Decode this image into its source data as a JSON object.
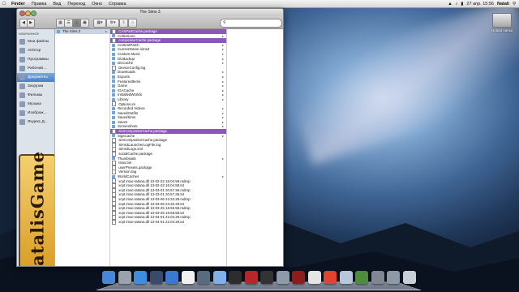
{
  "menubar": {
    "app": "Finder",
    "items": [
      "Правка",
      "Вид",
      "Переход",
      "Окно",
      "Справка"
    ],
    "clock": "27 апр.  15:56",
    "user": "Natali"
  },
  "desktop_icon": {
    "label": "Новая папка"
  },
  "window": {
    "title": "The Sims 3",
    "sidebar_heading": "ИЗБРАННОЕ",
    "sidebar": [
      {
        "label": "Мои файлы",
        "icon": "all-files-icon",
        "selected": false
      },
      {
        "label": "AirDrop",
        "icon": "airdrop-icon",
        "selected": false
      },
      {
        "label": "Программы",
        "icon": "applications-icon",
        "selected": false
      },
      {
        "label": "Рабочий...",
        "icon": "desktop-icon",
        "selected": false
      },
      {
        "label": "Документы",
        "icon": "documents-icon",
        "selected": true
      },
      {
        "label": "Загрузки",
        "icon": "downloads-icon",
        "selected": false
      },
      {
        "label": "Фильмы",
        "icon": "movies-icon",
        "selected": false
      },
      {
        "label": "Музыка",
        "icon": "music-icon",
        "selected": false
      },
      {
        "label": "Изображ...",
        "icon": "pictures-icon",
        "selected": false
      },
      {
        "label": "Яндекс.Д...",
        "icon": "yandex-disk-icon",
        "selected": false
      }
    ],
    "banner_text": "NatalisGame",
    "column1": [
      {
        "label": "The Sims 3",
        "folder": true
      }
    ],
    "column2": [
      {
        "label": "CASPartCache.package",
        "folder": false,
        "style": "hl"
      },
      {
        "label": "Collections",
        "folder": true,
        "style": ""
      },
      {
        "label": "compositorCache.package",
        "folder": false,
        "style": "hl"
      },
      {
        "label": "ContentPatch",
        "folder": true,
        "style": ""
      },
      {
        "label": "CurrentGame.sims3",
        "folder": true,
        "style": ""
      },
      {
        "label": "Custom Music",
        "folder": true,
        "style": ""
      },
      {
        "label": "DCBackup",
        "folder": true,
        "style": ""
      },
      {
        "label": "DCCache",
        "folder": true,
        "style": ""
      },
      {
        "label": "DeviceConfig.log",
        "folder": false,
        "style": ""
      },
      {
        "label": "Downloads",
        "folder": true,
        "style": ""
      },
      {
        "label": "Exports",
        "folder": true,
        "style": ""
      },
      {
        "label": "FeaturedItems",
        "folder": true,
        "style": ""
      },
      {
        "label": "Game",
        "folder": true,
        "style": ""
      },
      {
        "label": "IGACache",
        "folder": true,
        "style": ""
      },
      {
        "label": "InstalledWorlds",
        "folder": true,
        "style": ""
      },
      {
        "label": "Library",
        "folder": true,
        "style": ""
      },
      {
        "label": "Options.ini",
        "folder": false,
        "style": ""
      },
      {
        "label": "Recorded Videos",
        "folder": true,
        "style": ""
      },
      {
        "label": "SavedOutfits",
        "folder": true,
        "style": ""
      },
      {
        "label": "SavedSims",
        "folder": true,
        "style": ""
      },
      {
        "label": "Saves",
        "folder": true,
        "style": ""
      },
      {
        "label": "Screenshots",
        "folder": true,
        "style": ""
      },
      {
        "label": "simCompositorCache.package",
        "folder": false,
        "style": "hl"
      },
      {
        "label": "SigsCache",
        "folder": true,
        "style": ""
      },
      {
        "label": "simCompositorCache.package",
        "folder": false,
        "style": ""
      },
      {
        "label": "Sims3LauncherLogFile.log",
        "folder": false,
        "style": ""
      },
      {
        "label": "Sims3Logs.xml",
        "folder": false,
        "style": ""
      },
      {
        "label": "socialCache.package",
        "folder": false,
        "style": ""
      },
      {
        "label": "Thumbnails",
        "folder": true,
        "style": ""
      },
      {
        "label": "tslus.bin",
        "folder": false,
        "style": ""
      },
      {
        "label": "userPresets.package",
        "folder": false,
        "style": ""
      },
      {
        "label": "Version.tag",
        "folder": false,
        "style": ""
      },
      {
        "label": "WorldCaches",
        "folder": true,
        "style": ""
      },
      {
        "label": "xcpt imac-tatana.dll 13-02-22 16.04.58.mdmp",
        "folder": false,
        "style": ""
      },
      {
        "label": "xcpt imac-tatana.dll 13-02-22 16.04.58.txt",
        "folder": false,
        "style": ""
      },
      {
        "label": "xcpt imac-tatana.dll 13-03-01 20.57.36.mdmp",
        "folder": false,
        "style": ""
      },
      {
        "label": "xcpt imac-tatana.dll 13-03-01 20.57.36.txt",
        "folder": false,
        "style": ""
      },
      {
        "label": "xcpt imac-tatana.dll 13-03-06 23.32.28.mdmp",
        "folder": false,
        "style": ""
      },
      {
        "label": "xcpt imac-tatana.dll 13-03-06 23.32.28.txt",
        "folder": false,
        "style": ""
      },
      {
        "label": "xcpt imac-tatana.dll 13-03-25 18.58.58.mdmp",
        "folder": false,
        "style": ""
      },
      {
        "label": "xcpt imac-tatana.dll 13-03-25 18.58.58.txt",
        "folder": false,
        "style": ""
      },
      {
        "label": "xcpt imac-tatana.dll 13-04-01 22.04.29.mdmp",
        "folder": false,
        "style": ""
      },
      {
        "label": "xcpt imac-tatana.dll 13-04-01 22.04.29.txt",
        "folder": false,
        "style": ""
      }
    ]
  },
  "dock": [
    {
      "name": "finder-icon",
      "color": "#4a86d8"
    },
    {
      "name": "launchpad-icon",
      "color": "#9aa3ad"
    },
    {
      "name": "safari-icon",
      "color": "#3d8ee0"
    },
    {
      "name": "mission-control-icon",
      "color": "#3a4a6b"
    },
    {
      "name": "app-store-icon",
      "color": "#3b79d1"
    },
    {
      "name": "calendar-icon",
      "color": "#f1f1f1"
    },
    {
      "name": "photo-icon",
      "color": "#5b6b7e"
    },
    {
      "name": "itunes-icon",
      "color": "#7fb0e8"
    },
    {
      "name": "game-icon",
      "color": "#2d2d2d"
    },
    {
      "name": "photo-booth-icon",
      "color": "#b8252a"
    },
    {
      "name": "final-cut-icon",
      "color": "#333"
    },
    {
      "name": "ilife-icon",
      "color": "#8d9aa8"
    },
    {
      "name": "dictionary-icon",
      "color": "#8b1d1d"
    },
    {
      "name": "preview-icon",
      "color": "#e5e5e5"
    },
    {
      "name": "chrome-icon",
      "color": "#e1432f"
    },
    {
      "name": "mail-icon",
      "color": "#b7c6d8"
    },
    {
      "name": "sims-icon",
      "color": "#4e8b3c"
    },
    {
      "name": "system-preferences-icon",
      "color": "#7d8893"
    },
    {
      "name": "downloads-stack-icon",
      "color": "#8e9aa8"
    },
    {
      "name": "trash-icon",
      "color": "#c8cfd6"
    }
  ]
}
